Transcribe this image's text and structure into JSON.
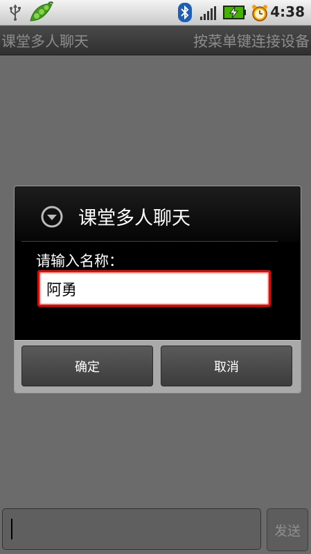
{
  "status_bar": {
    "time": "4:38",
    "icons": [
      "usb-icon",
      "pea-app-icon",
      "bluetooth-icon",
      "signal-icon",
      "battery-charging-icon",
      "alarm-icon"
    ]
  },
  "title_bar": {
    "title": "课堂多人聊天",
    "subtitle": "按菜单键连接设备"
  },
  "dialog": {
    "title": "课堂多人聊天",
    "prompt": "请输入名称：",
    "input_value": "阿勇",
    "ok_label": "确定",
    "cancel_label": "取消",
    "accent_color": "#d10f0f"
  },
  "bottom_bar": {
    "message_value": "",
    "send_label": "发送"
  }
}
